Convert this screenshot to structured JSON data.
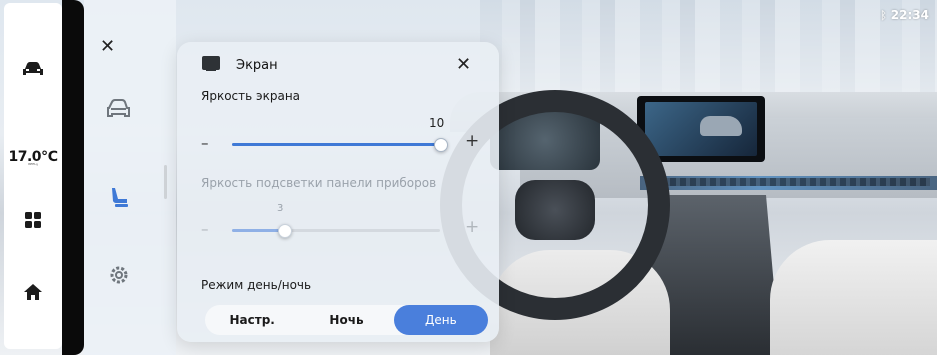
{
  "status": {
    "time": "22:34",
    "bluetooth_icon": "bluetooth-icon"
  },
  "leftbar": {
    "items": [
      {
        "icon": "car-icon"
      },
      {
        "temperature": "17.0℃",
        "sublabel": "ᴳᴱᴱᴸᵞ"
      },
      {
        "icon": "apps-grid-icon"
      },
      {
        "icon": "home-icon"
      }
    ]
  },
  "sidebar": {
    "close_icon": "close-icon",
    "items": [
      {
        "icon": "car-settings-icon"
      },
      {
        "icon": "seat-icon",
        "active": true
      },
      {
        "icon": "gear-icon"
      }
    ]
  },
  "dialog": {
    "title": "Экран",
    "title_icon": "monitor-icon",
    "close_icon": "close-icon",
    "brightness": {
      "label": "Яркость экрана",
      "value": "10",
      "fraction": 1.0,
      "minus": "–",
      "plus": "+"
    },
    "panel_brightness": {
      "label": "Яркость подсветки панели приборов",
      "value": "3",
      "fraction": 0.25,
      "minus": "–",
      "plus": "+"
    },
    "day_night": {
      "label": "Режим день/ночь",
      "options": [
        "Настр.",
        "Ночь",
        "День"
      ],
      "selected": "День"
    }
  },
  "colors": {
    "accent": "#4a7fdc",
    "slider_fill": "#3f79d6"
  }
}
